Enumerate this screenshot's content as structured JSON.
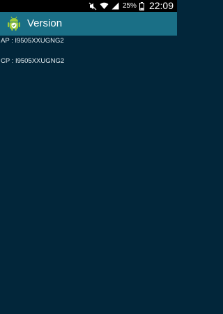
{
  "status_bar": {
    "icons": [
      "mute-icon",
      "wifi-icon",
      "signal-icon",
      "battery-icon"
    ],
    "battery_percent": "25%",
    "time": "22:09"
  },
  "action_bar": {
    "icon": "android-shield-icon",
    "title": "Version",
    "background_color": "#1a6f86"
  },
  "content": {
    "background_color": "#02263a",
    "ap_line": "AP : I9505XXUGNG2",
    "cp_line": "CP : I9505XXUGNG2"
  }
}
